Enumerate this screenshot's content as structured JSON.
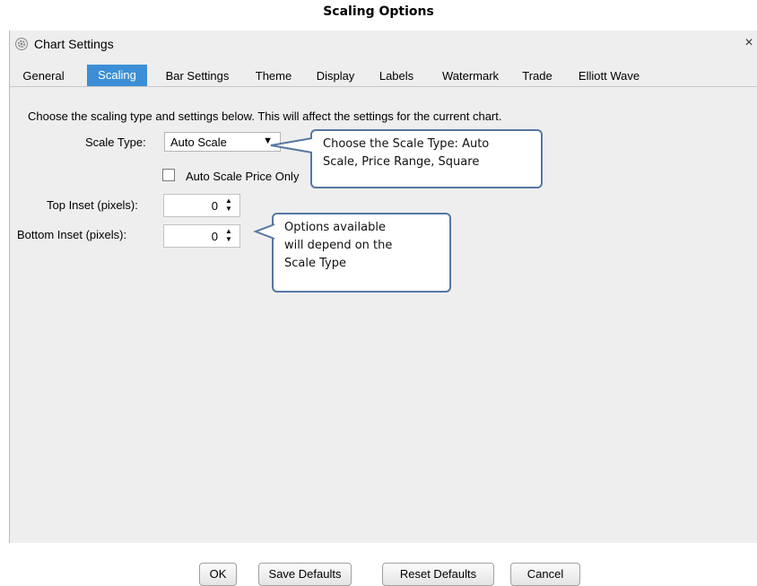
{
  "caption": "Scaling Options",
  "window": {
    "title": "Chart Settings",
    "close_glyph": "×",
    "icon": "gear-icon"
  },
  "tabs": [
    {
      "label": "General",
      "active": false
    },
    {
      "label": "Scaling",
      "active": true
    },
    {
      "label": "Bar Settings",
      "active": false
    },
    {
      "label": "Theme",
      "active": false
    },
    {
      "label": "Display",
      "active": false
    },
    {
      "label": "Labels",
      "active": false
    },
    {
      "label": "Watermark",
      "active": false
    },
    {
      "label": "Trade",
      "active": false
    },
    {
      "label": "Elliott Wave",
      "active": false
    }
  ],
  "scaling": {
    "description": "Choose the scaling type and settings below. This will affect the settings for the current chart.",
    "scale_type_label": "Scale Type:",
    "scale_type_value": "Auto Scale",
    "dropdown_arrow": "▼",
    "auto_scale_price_only_label": "Auto Scale Price Only",
    "auto_scale_price_only_checked": false,
    "top_inset_label": "Top Inset (pixels):",
    "top_inset_value": "0",
    "bottom_inset_label": "Bottom Inset (pixels):",
    "bottom_inset_value": "0",
    "spin_up": "▲",
    "spin_down": "▼"
  },
  "callouts": {
    "scale_type": {
      "line1": "Choose the Scale Type: Auto",
      "line2": "Scale, Price Range, Square"
    },
    "options": {
      "line1": "Options available",
      "line2": "will  depend on the",
      "line3": "Scale Type"
    }
  },
  "buttons": {
    "ok": "OK",
    "save_defaults": "Save Defaults",
    "reset_defaults": "Reset Defaults",
    "cancel": "Cancel"
  },
  "colors": {
    "active_tab": "#3c8fd6",
    "callout_border": "#5577a3",
    "window_bg": "#eeeeee"
  }
}
